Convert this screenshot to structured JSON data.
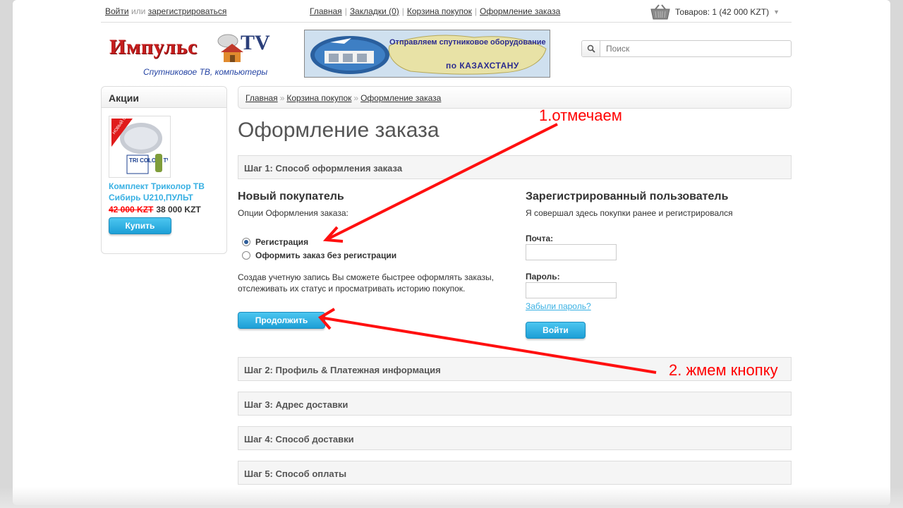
{
  "topbar": {
    "login": "Войти",
    "or": "или",
    "register": "зарегистрироваться",
    "links": [
      "Главная",
      "Закладки (0)",
      "Корзина покупок",
      "Оформление заказа"
    ],
    "cart": "Товаров: 1 (42 000 KZT)"
  },
  "logo": {
    "name": "Импульс",
    "tv": "TV",
    "tagline": "Спутниковое ТВ, компьютеры"
  },
  "banner": {
    "line1": "Отправляем спутниковое оборудование",
    "line2": "по КАЗАХСТАНУ"
  },
  "search": {
    "placeholder": "Поиск"
  },
  "sidebar": {
    "title": "Акции",
    "product": {
      "name": "Комплект Триколор ТВ Сибирь U210,ПУЛЬТ",
      "old_price": "42 000 KZT",
      "new_price": "38 000 KZT",
      "buy_label": "Купить",
      "badge": "НОВЫЙ СПУТНИК",
      "logo_text": "TRI COLO R TV"
    }
  },
  "breadcrumb": [
    "Главная",
    "Корзина покупок",
    "Оформление заказа"
  ],
  "page_title": "Оформление заказа",
  "step1": {
    "title": "Шаг 1: Способ оформления заказа",
    "new_customer": {
      "heading": "Новый покупатель",
      "options_label": "Опции Оформления заказа:",
      "options": [
        {
          "label": "Регистрация",
          "checked": true
        },
        {
          "label": "Оформить заказ без регистрации",
          "checked": false
        }
      ],
      "description": "Создав учетную запись Вы сможете быстрее оформлять заказы, отслеживать их статус и просматривать историю покупок.",
      "continue_label": "Продолжить"
    },
    "returning": {
      "heading": "Зарегистрированный пользователь",
      "subtitle": "Я совершал здесь покупки ранее и регистрировался",
      "email_label": "Почта:",
      "email_value": "",
      "password_label": "Пароль:",
      "password_value": "",
      "forgot": "Забыли пароль?",
      "login_label": "Войти"
    }
  },
  "steps": [
    "Шаг 2: Профиль & Платежная информация",
    "Шаг 3: Адрес доставки",
    "Шаг 4: Способ доставки",
    "Шаг 5: Способ оплаты"
  ],
  "annotations": {
    "first": "1.отмечаем",
    "second": "2. жмем кнопку",
    "color": "#ff0000"
  }
}
